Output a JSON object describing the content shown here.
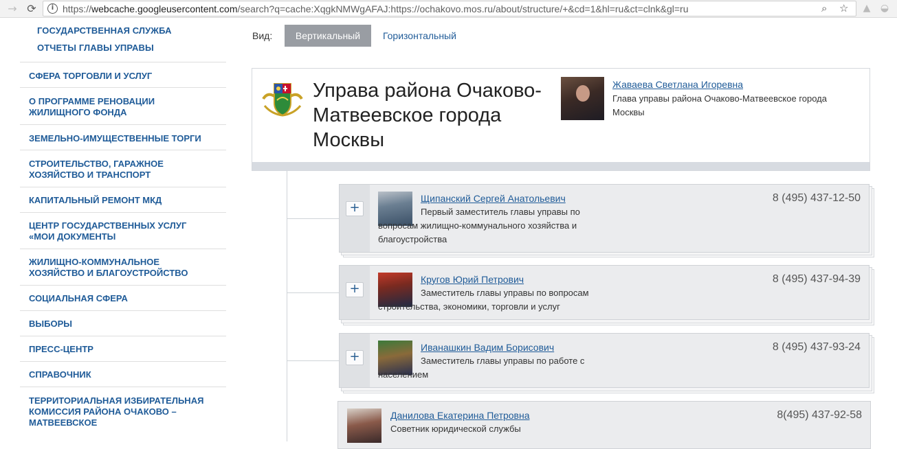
{
  "browser": {
    "url_prefix": "https://",
    "url_domain": "webcache.googleusercontent.com",
    "url_rest": "/search?q=cache:XqgkNMWgAFAJ:https://ochakovo.mos.ru/about/structure/+&cd=1&hl=ru&ct=clnk&gl=ru"
  },
  "sidebar": {
    "subitems": [
      "ГОСУДАРСТВЕННАЯ СЛУЖБА",
      "ОТЧЕТЫ ГЛАВЫ УПРАВЫ"
    ],
    "items": [
      "СФЕРА ТОРГОВЛИ И УСЛУГ",
      "О ПРОГРАММЕ РЕНОВАЦИИ\nЖИЛИЩНОГО ФОНДА",
      "ЗЕМЕЛЬНО-ИМУЩЕСТВЕННЫЕ ТОРГИ",
      "СТРОИТЕЛЬСТВО, ГАРАЖНОЕ\nХОЗЯЙСТВО И ТРАНСПОРТ",
      "КАПИТАЛЬНЫЙ РЕМОНТ МКД",
      "ЦЕНТР ГОСУДАРСТВЕННЫХ УСЛУГ\n«МОИ ДОКУМЕНТЫ",
      "ЖИЛИЩНО-КОММУНАЛЬНОЕ\nХОЗЯЙСТВО И БЛАГОУСТРОЙСТВО",
      "СОЦИАЛЬНАЯ СФЕРА",
      "ВЫБОРЫ",
      "ПРЕСС-ЦЕНТР",
      "СПРАВОЧНИК",
      "ТЕРРИТОРИАЛЬНАЯ ИЗБИРАТЕЛЬНАЯ\nКОМИССИЯ РАЙОНА ОЧАКОВО –\nМАТВЕЕВСКОЕ"
    ]
  },
  "view": {
    "label": "Вид:",
    "vertical": "Вертикальный",
    "horizontal": "Горизонтальный"
  },
  "org": {
    "title": "Управа района Очаково-Матвеевское города Москвы",
    "head_name": "Жаваева Светлана Игоревна",
    "head_role": "Глава управы района Очаково-Матвеевское города Москвы"
  },
  "staff": [
    {
      "name": "Щипанский Сергей Анатольевич",
      "phone": "8 (495) 437-12-50",
      "role": "Первый заместитель главы управы по вопросам жилищно-коммунального хозяйства и благоустройства"
    },
    {
      "name": "Кругов Юрий Петрович",
      "phone": "8 (495) 437-94-39",
      "role": "Заместитель главы управы по вопросам строительства, экономики, торговли и услуг"
    },
    {
      "name": "Иванашкин Вадим Борисович",
      "phone": "8 (495) 437-93-24",
      "role": "Заместитель главы управы по работе с населением"
    },
    {
      "name": "Данилова Екатерина Петровна",
      "phone": "8(495) 437-92-58",
      "role": "Советник юридической службы"
    }
  ],
  "icons": {
    "back": "back-arrow-icon",
    "forward": "forward-arrow-icon",
    "reload": "reload-icon",
    "info": "info-icon",
    "zoom": "zoom-icon",
    "bookmark": "star-icon",
    "expand": "plus-icon"
  },
  "colors": {
    "link": "#1f5b98",
    "active_tab": "#999da3",
    "card_bg": "#ebecee"
  }
}
